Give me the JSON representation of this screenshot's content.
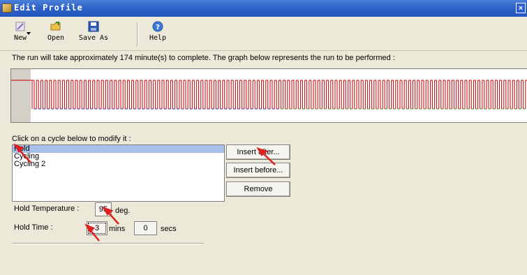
{
  "window": {
    "title": "Edit Profile",
    "close_glyph": "×"
  },
  "toolbar": {
    "buttons": [
      {
        "label": "New",
        "icon": "new-profile-icon"
      },
      {
        "label": "Open",
        "icon": "folder-icon"
      },
      {
        "label": "Save As",
        "icon": "floppy-icon"
      },
      {
        "label": "Help",
        "icon": "help-icon"
      }
    ]
  },
  "info_text": "The run will take approximately 174 minute(s) to complete. The graph below represents the run to be performed :",
  "graph": {
    "cycles_color": "#c00000",
    "low_color_1": "#1f1fb0",
    "low_color_2": "#2e8b2e",
    "hold_color": "#c00000"
  },
  "cycles": {
    "prompt": "Click on a cycle below to modify it :",
    "items": [
      "Hold",
      "Cycling",
      "Cycling 2"
    ],
    "selected_index": 0
  },
  "actions": {
    "insert_after": "Insert after...",
    "insert_before": "Insert before...",
    "remove": "Remove"
  },
  "hold": {
    "temperature_label": "Hold Temperature :",
    "temperature_value": "95",
    "temperature_unit": "deg.",
    "time_label": "Hold Time :",
    "mins_value": "3",
    "mins_unit": "mins",
    "secs_value": "0",
    "secs_unit": "secs"
  },
  "annotation_color": "#e02020"
}
